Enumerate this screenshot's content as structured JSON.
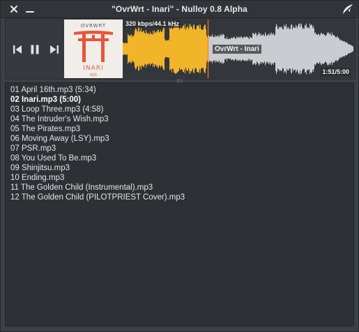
{
  "window": {
    "title": "\"OvrWrt - Inari\" - Nulloy 0.8 Alpha"
  },
  "player": {
    "bitrate": "320 kbps/44.1 kHz",
    "wave_title": "OvrWrt - Inari",
    "time": "1:51/5:00",
    "progress": 0.37,
    "album_art": {
      "brand": "OVRWRT",
      "title": "INARI",
      "subtitle": "稲荷"
    }
  },
  "colors": {
    "played_wave": "#f2b52a",
    "unplayed_wave": "#c9ccd0",
    "torii_red": "#e8543a",
    "accent_cursor": "#ff7a1a"
  },
  "icons": {
    "close": "close-icon",
    "minimize": "minimize-icon",
    "logo": "nulloy-logo-icon",
    "prev": "prev-icon",
    "pause": "pause-icon",
    "next": "next-icon"
  },
  "playlist": {
    "tracks": [
      "01 April 16th.mp3 (5:34)",
      "02 Inari.mp3 (5:00)",
      "03 Loop Three.mp3 (4:58)",
      "04 The Intruder's Wish.mp3",
      "05 The Pirates.mp3",
      "06 Moving Away (LSY).mp3",
      "07 PSR.mp3",
      "08 You Used To Be.mp3",
      "09 Shinjitsu.mp3",
      "10 Ending.mp3",
      "11 The Golden Child (Instrumental).mp3",
      "12 The Golden Child (PILOTPRIEST Cover).mp3"
    ],
    "current_index": 1
  }
}
